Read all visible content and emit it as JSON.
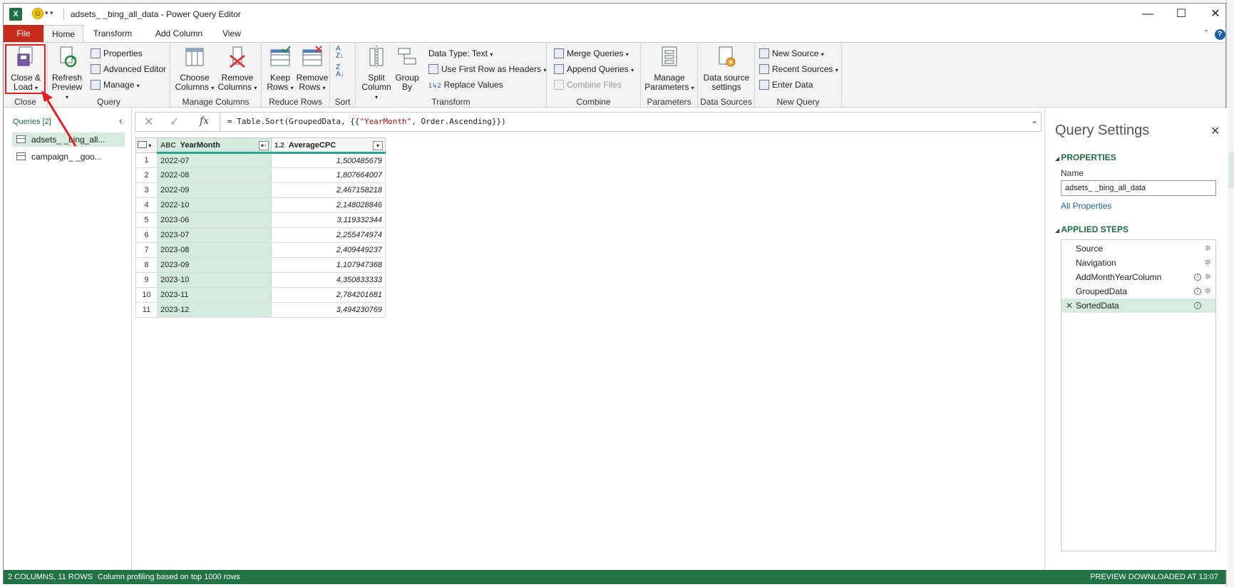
{
  "window": {
    "title": "adsets_       _bing_all_data - Power Query Editor",
    "minimize": "—",
    "maximize": "☐",
    "close": "✕"
  },
  "tabs": [
    {
      "label": "File"
    },
    {
      "label": "Home"
    },
    {
      "label": "Transform"
    },
    {
      "label": "Add Column"
    },
    {
      "label": "View"
    }
  ],
  "ribbon": {
    "close_group": {
      "label": "Close",
      "close_load_line1": "Close &",
      "close_load_line2": "Load"
    },
    "query_group": {
      "label": "Query",
      "refresh_line1": "Refresh",
      "refresh_line2": "Preview",
      "properties": "Properties",
      "advanced_editor": "Advanced Editor",
      "manage": "Manage"
    },
    "manage_columns_group": {
      "label": "Manage Columns",
      "choose_line1": "Choose",
      "choose_line2": "Columns",
      "remove_line1": "Remove",
      "remove_line2": "Columns"
    },
    "reduce_rows_group": {
      "label": "Reduce Rows",
      "keep_line1": "Keep",
      "keep_line2": "Rows",
      "remove_line1": "Remove",
      "remove_line2": "Rows"
    },
    "sort_group": {
      "label": "Sort"
    },
    "transform_group": {
      "label": "Transform",
      "split_line1": "Split",
      "split_line2": "Column",
      "group_line1": "Group",
      "group_line2": "By",
      "data_type": "Data Type: Text",
      "first_row_headers": "Use First Row as Headers",
      "replace_values": "Replace Values"
    },
    "combine_group": {
      "label": "Combine",
      "merge": "Merge Queries",
      "append": "Append Queries",
      "combine_files": "Combine Files"
    },
    "parameters_group": {
      "label": "Parameters",
      "manage_line1": "Manage",
      "manage_line2": "Parameters"
    },
    "data_sources_group": {
      "label": "Data Sources",
      "settings_line1": "Data source",
      "settings_line2": "settings"
    },
    "new_query_group": {
      "label": "New Query",
      "new_source": "New Source",
      "recent_sources": "Recent Sources",
      "enter_data": "Enter Data"
    }
  },
  "queries_pane": {
    "header": "Queries [2]",
    "items": [
      {
        "label": "adsets_       _bing_all..."
      },
      {
        "label": "campaign_       _goo..."
      }
    ]
  },
  "formula": {
    "prefix": "= Table.Sort(GroupedData, {{",
    "string": "\"YearMonth\"",
    "suffix": ", Order.Ascending}})"
  },
  "grid": {
    "columns": [
      {
        "type_icon": "ABC",
        "name": "YearMonth"
      },
      {
        "type_icon": "1.2",
        "name": "AverageCPC"
      }
    ],
    "rows": [
      {
        "n": "1",
        "ym": "2022-07",
        "cpc": "1,500485679"
      },
      {
        "n": "2",
        "ym": "2022-08",
        "cpc": "1,807664007"
      },
      {
        "n": "3",
        "ym": "2022-09",
        "cpc": "2,467158218"
      },
      {
        "n": "4",
        "ym": "2022-10",
        "cpc": "2,148028846"
      },
      {
        "n": "5",
        "ym": "2023-06",
        "cpc": "3,119332344"
      },
      {
        "n": "6",
        "ym": "2023-07",
        "cpc": "2,255474974"
      },
      {
        "n": "7",
        "ym": "2023-08",
        "cpc": "2,409449237"
      },
      {
        "n": "8",
        "ym": "2023-09",
        "cpc": "1,107947368"
      },
      {
        "n": "9",
        "ym": "2023-10",
        "cpc": "4,350833333"
      },
      {
        "n": "10",
        "ym": "2023-11",
        "cpc": "2,784201681"
      },
      {
        "n": "11",
        "ym": "2023-12",
        "cpc": "3,494230769"
      }
    ]
  },
  "query_settings": {
    "title": "Query Settings",
    "properties_header": "PROPERTIES",
    "name_label": "Name",
    "name_value": "adsets_       _bing_all_data",
    "all_properties": "All Properties",
    "applied_steps_header": "APPLIED STEPS",
    "steps": [
      {
        "label": "Source"
      },
      {
        "label": "Navigation"
      },
      {
        "label": "AddMonthYearColumn"
      },
      {
        "label": "GroupedData"
      },
      {
        "label": "SortedData"
      }
    ]
  },
  "status": {
    "left": "2 COLUMNS, 11 ROWS",
    "middle": "Column profiling based on top 1000 rows",
    "right": "PREVIEW DOWNLOADED AT 13:07"
  },
  "colors": {
    "accent_green": "#217346",
    "selection_green": "#d4ecdd",
    "file_tab_red": "#c42b1c",
    "highlight_red": "#e02020"
  }
}
